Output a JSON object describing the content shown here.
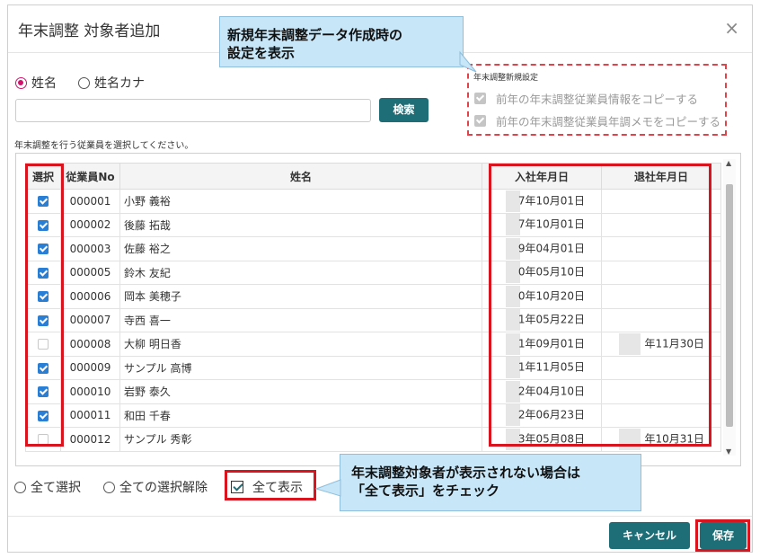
{
  "dialog": {
    "title": "年末調整 対象者追加",
    "close_glyph": "×"
  },
  "name_mode": {
    "options": [
      {
        "label": "姓名",
        "selected": true
      },
      {
        "label": "姓名カナ",
        "selected": false
      }
    ]
  },
  "search": {
    "value": "",
    "placeholder": "",
    "button_label": "検索"
  },
  "instruction": "年末調整を行う従業員を選択してください。",
  "settings": {
    "title": "年末調整新規設定",
    "items": [
      {
        "label": "前年の年末調整従業員情報をコピーする",
        "checked": true,
        "disabled": true
      },
      {
        "label": "前年の年末調整従業員年調メモをコピーする",
        "checked": true,
        "disabled": true
      }
    ]
  },
  "table": {
    "headers": [
      "選択",
      "従業員No",
      "姓名",
      "入社年月日",
      "退社年月日"
    ],
    "rows": [
      {
        "checked": true,
        "no": "000001",
        "name": "小野 義裕",
        "hire": "7年10月01日",
        "retire": ""
      },
      {
        "checked": true,
        "no": "000002",
        "name": "後藤 拓哉",
        "hire": "7年10月01日",
        "retire": ""
      },
      {
        "checked": true,
        "no": "000003",
        "name": "佐藤 裕之",
        "hire": "9年04月01日",
        "retire": ""
      },
      {
        "checked": true,
        "no": "000005",
        "name": "鈴木 友紀",
        "hire": "0年05月10日",
        "retire": ""
      },
      {
        "checked": true,
        "no": "000006",
        "name": "岡本 美穂子",
        "hire": "0年10月20日",
        "retire": ""
      },
      {
        "checked": true,
        "no": "000007",
        "name": "寺西 喜一",
        "hire": "1年05月22日",
        "retire": ""
      },
      {
        "checked": false,
        "no": "000008",
        "name": "大柳 明日香",
        "hire": "1年09月01日",
        "retire": "年11月30日"
      },
      {
        "checked": true,
        "no": "000009",
        "name": "サンプル 高博",
        "hire": "1年11月05日",
        "retire": ""
      },
      {
        "checked": true,
        "no": "000010",
        "name": "岩野 泰久",
        "hire": "2年04月10日",
        "retire": ""
      },
      {
        "checked": true,
        "no": "000011",
        "name": "和田 千春",
        "hire": "2年06月23日",
        "retire": ""
      },
      {
        "checked": false,
        "no": "000012",
        "name": "サンプル 秀彰",
        "hire": "3年05月08日",
        "retire": "年10月31日"
      }
    ]
  },
  "footer": {
    "select_all": "全て選択",
    "deselect_all": "全ての選択解除",
    "show_all": "全て表示",
    "show_all_checked": true,
    "cancel_label": "キャンセル",
    "save_label": "保存"
  },
  "callouts": {
    "top": "新規年末調整データ作成時の\n設定を表示",
    "bottom": "年末調整対象者が表示されない場合は\n「全て表示」をチェック"
  },
  "colors": {
    "accent": "#1e6e78",
    "highlight": "#d9141e",
    "check": "#2a7fd4",
    "radio": "#d0146e",
    "callout_bg": "#c7e6f8"
  }
}
